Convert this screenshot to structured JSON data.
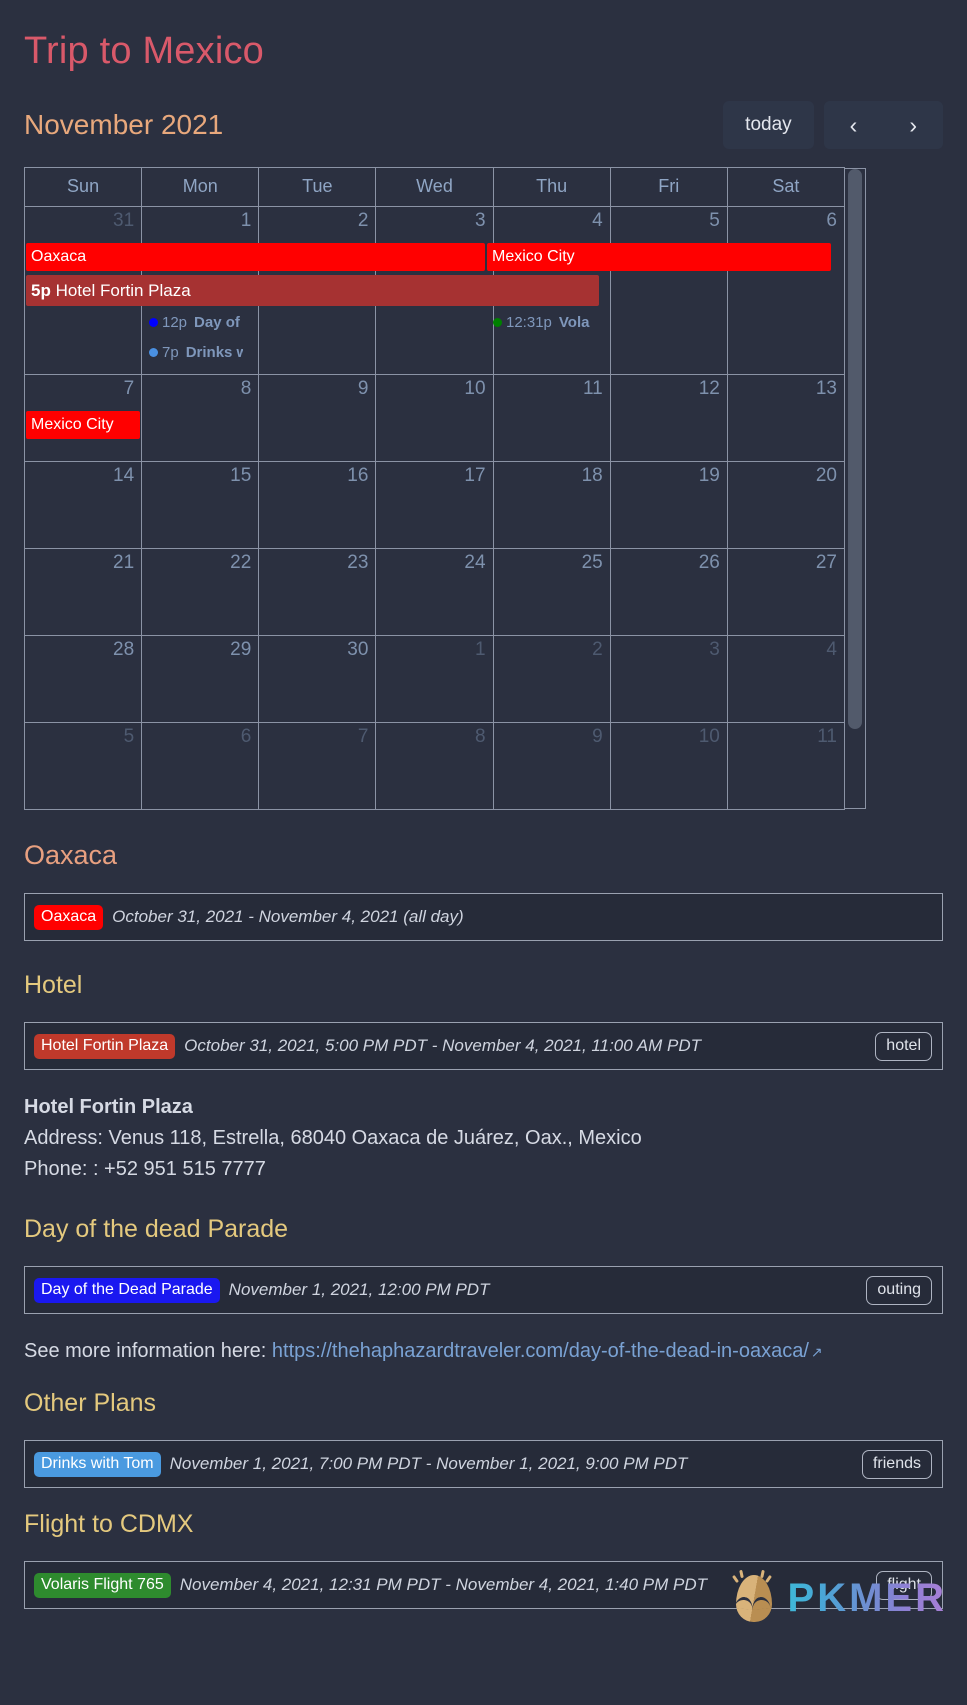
{
  "page": {
    "title": "Trip to Mexico"
  },
  "calendar": {
    "month_label": "November 2021",
    "toolbar": {
      "today": "today",
      "prev": "‹",
      "next": "›"
    },
    "weekdays": [
      "Sun",
      "Mon",
      "Tue",
      "Wed",
      "Thu",
      "Fri",
      "Sat"
    ],
    "weeks": [
      {
        "days": [
          {
            "num": "31",
            "other": true
          },
          {
            "num": "1",
            "other": false
          },
          {
            "num": "2",
            "other": false
          },
          {
            "num": "3",
            "other": false
          },
          {
            "num": "4",
            "other": false
          },
          {
            "num": "5",
            "other": false
          },
          {
            "num": "6",
            "other": false
          }
        ]
      },
      {
        "days": [
          {
            "num": "7",
            "other": false
          },
          {
            "num": "8",
            "other": false
          },
          {
            "num": "9",
            "other": false
          },
          {
            "num": "10",
            "other": false
          },
          {
            "num": "11",
            "other": false
          },
          {
            "num": "12",
            "other": false
          },
          {
            "num": "13",
            "other": false
          }
        ]
      },
      {
        "days": [
          {
            "num": "14",
            "other": false
          },
          {
            "num": "15",
            "other": false
          },
          {
            "num": "16",
            "other": false
          },
          {
            "num": "17",
            "other": false
          },
          {
            "num": "18",
            "other": false
          },
          {
            "num": "19",
            "other": false
          },
          {
            "num": "20",
            "other": false
          }
        ]
      },
      {
        "days": [
          {
            "num": "21",
            "other": false
          },
          {
            "num": "22",
            "other": false
          },
          {
            "num": "23",
            "other": false
          },
          {
            "num": "24",
            "other": false
          },
          {
            "num": "25",
            "other": false
          },
          {
            "num": "26",
            "other": false
          },
          {
            "num": "27",
            "other": false
          }
        ]
      },
      {
        "days": [
          {
            "num": "28",
            "other": false
          },
          {
            "num": "29",
            "other": false
          },
          {
            "num": "30",
            "other": false
          },
          {
            "num": "1",
            "other": true
          },
          {
            "num": "2",
            "other": true
          },
          {
            "num": "3",
            "other": true
          },
          {
            "num": "4",
            "other": true
          }
        ]
      },
      {
        "days": [
          {
            "num": "5",
            "other": true
          },
          {
            "num": "6",
            "other": true
          },
          {
            "num": "7",
            "other": true
          },
          {
            "num": "8",
            "other": true
          },
          {
            "num": "9",
            "other": true
          },
          {
            "num": "10",
            "other": true
          },
          {
            "num": "11",
            "other": true
          }
        ]
      }
    ],
    "events": {
      "oaxaca_bar": "Oaxaca",
      "mexico_city_bar": "Mexico City",
      "hotel_bar_time": "5p",
      "hotel_bar_title": "Hotel Fortin Plaza",
      "parade_time": "12p",
      "parade_title": "Day of",
      "drinks_time": "7p",
      "drinks_title": "Drinks w",
      "flight_time": "12:31p",
      "flight_title": "Vola",
      "mexico_city_week2": "Mexico City"
    },
    "colors": {
      "allday_red": "#ff0000",
      "hotel_red": "#a63232",
      "parade_dot": "#0000ff",
      "drinks_dot": "#4a90e2",
      "flight_dot": "#008000"
    }
  },
  "sections": [
    {
      "heading": "Oaxaca",
      "heading_style": "salmon",
      "events": [
        {
          "badge": "Oaxaca",
          "badge_color": "#ff0000",
          "date": "October 31, 2021 - November 4, 2021 (all day)",
          "tag": null
        }
      ],
      "notes": []
    },
    {
      "heading": "Hotel",
      "heading_style": "yellow",
      "events": [
        {
          "badge": "Hotel Fortin Plaza",
          "badge_color": "#c0392b",
          "date": "October 31, 2021, 5:00 PM PDT - November 4, 2021, 11:00 AM PDT",
          "tag": "hotel"
        }
      ],
      "notes": [
        {
          "text": "Hotel Fortin Plaza",
          "bold": true
        },
        {
          "text": "Address: Venus 118, Estrella, 68040 Oaxaca de Juárez, Oax., Mexico",
          "bold": false
        },
        {
          "text": "Phone: : +52 951 515 7777",
          "bold": false
        }
      ]
    },
    {
      "heading": "Day of the dead Parade",
      "heading_style": "yellow",
      "events": [
        {
          "badge": "Day of the Dead Parade",
          "badge_color": "#1a18f0",
          "date": "November 1, 2021, 12:00 PM PDT",
          "tag": "outing"
        }
      ],
      "notes": []
    },
    {
      "heading": "Other Plans",
      "heading_style": "yellow",
      "events": [
        {
          "badge": "Drinks with Tom",
          "badge_color": "#4a9ae0",
          "date": "November 1, 2021, 7:00 PM PDT - November 1, 2021, 9:00 PM PDT",
          "tag": "friends"
        }
      ],
      "notes": []
    },
    {
      "heading": "Flight to CDMX",
      "heading_style": "yellow",
      "events": [
        {
          "badge": "Volaris Flight 765",
          "badge_color": "#2e8b2e",
          "date": "November 4, 2021, 12:31 PM PDT - November 4, 2021, 1:40 PM PDT",
          "tag": "flight"
        }
      ],
      "notes": []
    }
  ],
  "parade_link": {
    "prefix": "See more information here: ",
    "url_text": "https://thehaphazardtraveler.com/day-of-the-dead-in-oaxaca/",
    "ext_icon": "↗"
  },
  "watermark": {
    "text": "PKMER"
  }
}
